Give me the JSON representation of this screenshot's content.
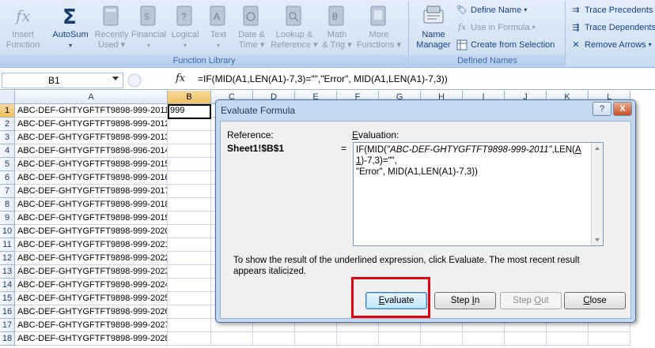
{
  "ribbon": {
    "function_library": {
      "label": "Function Library",
      "buttons": [
        {
          "label": "Insert\nFunction",
          "icon": "fx-icon",
          "enabled": false
        },
        {
          "label": "AutoSum",
          "icon": "sigma-icon",
          "enabled": true
        },
        {
          "label": "Recently\nUsed",
          "icon": "book-icon",
          "enabled": false
        },
        {
          "label": "Financial",
          "icon": "book-icon",
          "enabled": false
        },
        {
          "label": "Logical",
          "icon": "question-book-icon",
          "enabled": false
        },
        {
          "label": "Text",
          "icon": "text-book-icon",
          "enabled": false
        },
        {
          "label": "Date &\nTime",
          "icon": "clock-book-icon",
          "enabled": false
        },
        {
          "label": "Lookup &\nReference",
          "icon": "magnifier-book-icon",
          "enabled": false
        },
        {
          "label": "Math\n& Trig",
          "icon": "theta-book-icon",
          "enabled": false
        },
        {
          "label": "More\nFunctions",
          "icon": "books-icon",
          "enabled": false
        }
      ]
    },
    "defined_names": {
      "label": "Defined Names",
      "name_manager": "Name\nManager",
      "define_name": "Define Name",
      "use_in_formula": "Use in Formula",
      "create_from_selection": "Create from Selection"
    },
    "formula_auditing": {
      "trace_precedents": "Trace Precedents",
      "trace_dependents": "Trace Dependents",
      "remove_arrows": "Remove Arrows"
    }
  },
  "formula_bar": {
    "name_box": "B1",
    "fx": "fx",
    "formula": "=IF(MID(A1,LEN(A1)-7,3)=\"\",\"Error\", MID(A1,LEN(A1)-7,3))"
  },
  "grid": {
    "columns": [
      "A",
      "B",
      "C",
      "D",
      "E",
      "F",
      "G",
      "H",
      "I",
      "J",
      "K",
      "L"
    ],
    "row_numbers": [
      "1",
      "2",
      "3",
      "4",
      "5",
      "6",
      "7",
      "8",
      "9",
      "10",
      "11",
      "12",
      "13",
      "14",
      "15",
      "16",
      "17",
      "18"
    ],
    "col_a": [
      "ABC-DEF-GHTYGFTFT9898-999-2011",
      "ABC-DEF-GHTYGFTFT9898-999-2012",
      "ABC-DEF-GHTYGFTFT9898-999-2013",
      "ABC-DEF-GHTYGFTFT9898-996-2014",
      "ABC-DEF-GHTYGFTFT9898-999-2015",
      "ABC-DEF-GHTYGFTFT9898-999-2016",
      "ABC-DEF-GHTYGFTFT9898-999-2017",
      "ABC-DEF-GHTYGFTFT9898-999-2018",
      "ABC-DEF-GHTYGFTFT9898-999-2019",
      "ABC-DEF-GHTYGFTFT9898-999-2020",
      "ABC-DEF-GHTYGFTFT9898-999-2021",
      "ABC-DEF-GHTYGFTFT9898-999-2022",
      "ABC-DEF-GHTYGFTFT9898-999-2023",
      "ABC-DEF-GHTYGFTFT9898-999-2024",
      "ABC-DEF-GHTYGFTFT9898-999-2025",
      "ABC-DEF-GHTYGFTFT9898-999-2026",
      "ABC-DEF-GHTYGFTFT9898-999-2027",
      "ABC-DEF-GHTYGFTFT9898-999-2028"
    ],
    "b1": "999"
  },
  "dialog": {
    "title": "Evaluate Formula",
    "help": "?",
    "close": "X",
    "reference_label": "Reference:",
    "reference_value": "Sheet1!$B$1",
    "equals": "=",
    "evaluation_label": "Evaluation:",
    "evaluation_line1_pre": "IF(MID(",
    "evaluation_line1_italic": "\"ABC-DEF-GHTYGFTFT9898-999-2011\"",
    "evaluation_line1_mid": ",LEN(",
    "evaluation_line1_underlined": "A1",
    "evaluation_line1_post": ")-7,3)=\"\",",
    "evaluation_line2": "\"Error\", MID(A1,LEN(A1)-7,3))",
    "info": "To show the result of the underlined expression, click Evaluate.  The most recent result appears italicized.",
    "buttons": {
      "evaluate": "Evaluate",
      "step_in": "Step In",
      "step_out": "Step Out",
      "close": "Close"
    }
  },
  "colors": {
    "highlight_box": "#e0000f",
    "ribbon_text": "#15428b",
    "active_header": "#f1c15f"
  }
}
